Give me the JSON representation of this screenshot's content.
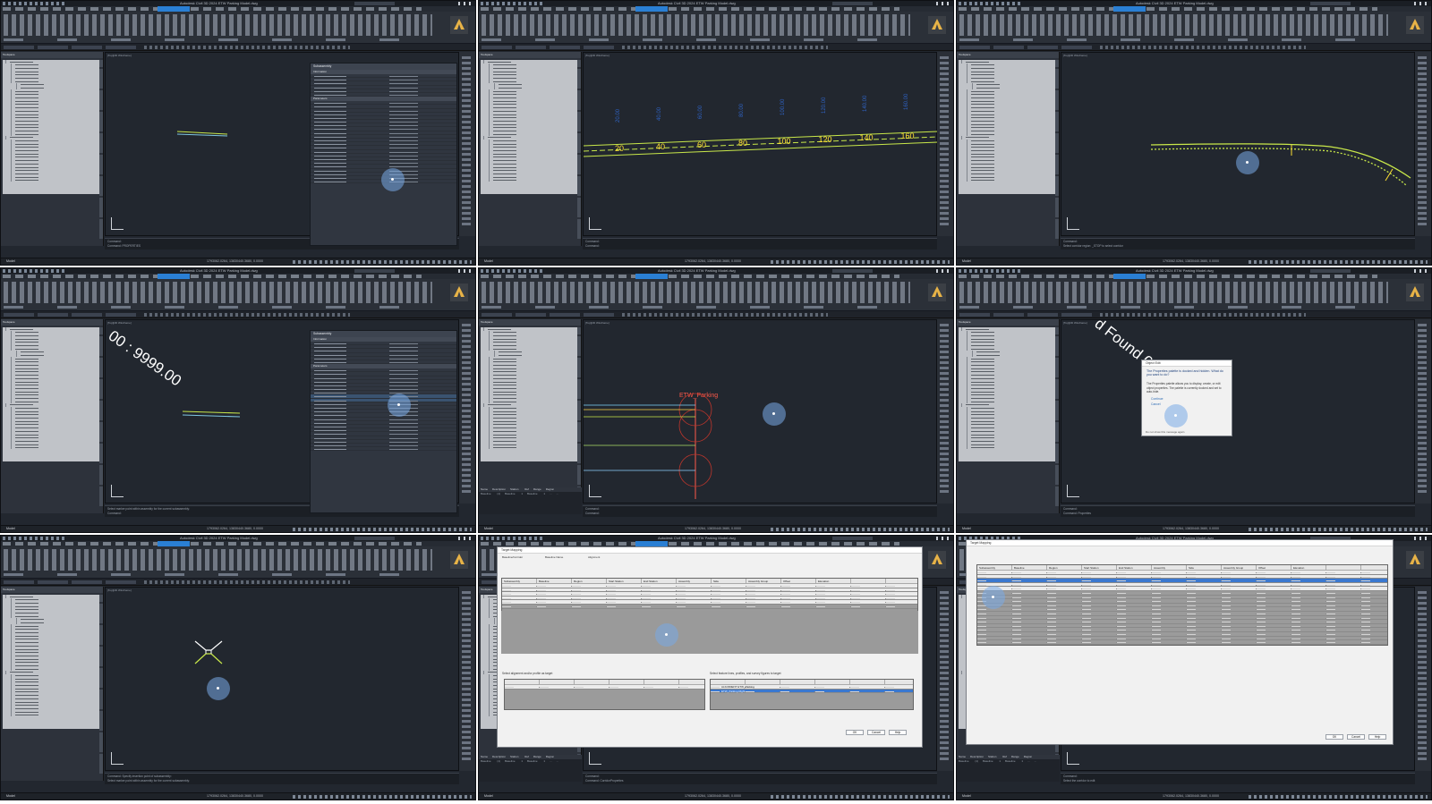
{
  "app": {
    "title": "Autodesk Civil 3D 2024   ETW Parking Model.dwg",
    "model_tab": "Model",
    "viewport_label": "[Top][2D Wireframe]",
    "coords": "1793062.0264, 13830440.3680, 0.0000",
    "status_model": "MODEL"
  },
  "toolspace": {
    "title": "Toolspace",
    "tab": "Prospector",
    "drawing": "ETW Parking Model.dwg"
  },
  "frames": [
    {
      "id": "f1",
      "cmd": [
        "Command:",
        "Command: PROPERTIES"
      ],
      "props_title": "Subassembly",
      "props_sections": [
        "Information",
        "Parameters"
      ]
    },
    {
      "id": "f2",
      "stations": [
        "20",
        "40",
        "60",
        "80",
        "100",
        "120",
        "140",
        "160"
      ],
      "top_labels": [
        "20.00",
        "40.00",
        "60.00",
        "80.00",
        "100.00",
        "120.00",
        "140.00",
        "160.00"
      ],
      "cmd": [
        "Command:",
        "Command:"
      ]
    },
    {
      "id": "f3",
      "cmd": [
        "Command:",
        "Select corridor region: _STOP to select corridor"
      ]
    },
    {
      "id": "f4",
      "rot_label": "00 : 9999.00",
      "cmd": [
        "Select marker point within assembly for the current subassembly:",
        "Command:"
      ],
      "props_title": "Subassembly",
      "props_sections": [
        "Information",
        "Parameters"
      ]
    },
    {
      "id": "f5",
      "label": "ETW_Parking",
      "cmd": [
        "Command:",
        "Command:"
      ]
    },
    {
      "id": "f6",
      "rot_label": "d Found  0.0",
      "dialog_title": "Object Edit",
      "dialog_heading": "The Properties palette is docked and hidden. What do you want to do?",
      "dialog_body": "The Properties palette allows you to display, create, or edit object properties. The palette is currently docked and set to auto-hide.",
      "dialog_options": [
        "Continue",
        "Cancel"
      ],
      "dialog_footer": "Do not show this message again",
      "cmd": [
        "Command:",
        "Command: Properties"
      ]
    },
    {
      "id": "f7",
      "cmd": [
        "Command: Specify insertion point of subassembly:",
        "Select marker point within assembly for the current subassembly:"
      ]
    },
    {
      "id": "f8",
      "dialog_title": "Target Mapping",
      "dialog_fields": [
        "Baseline/Corridor",
        "Baseline Name",
        "Alignment"
      ],
      "grid_headers": [
        "Subassembly",
        "Baseline",
        "Region",
        "Start Station",
        "End Station",
        "Assembly",
        "Side",
        "Assembly Group",
        "Offset",
        "Elevation"
      ],
      "lower_label": "Select alignment and/or profile as target",
      "right_label": "Select feature lines, profiles, and survey figures to target",
      "target_rows": [
        "ALIGNMENT ETW_Parking",
        "ETW_Parking Right"
      ],
      "buttons": [
        "OK",
        "Cancel",
        "Help"
      ],
      "cmd": [
        "Command:",
        "Command: CorridorProperties"
      ]
    },
    {
      "id": "f9",
      "dialog_title": "Target Mapping",
      "grid_headers": [
        "Subassembly",
        "Baseline",
        "Region",
        "Start Station",
        "End Station",
        "Assembly",
        "Side",
        "Assembly Group",
        "Offset",
        "Elevation"
      ],
      "buttons": [
        "OK",
        "Cancel",
        "Help"
      ],
      "cmd": [
        "Command:",
        "Select the corridor to edit"
      ]
    }
  ],
  "bottom_table": {
    "headers": [
      "Name",
      "Description",
      "Station Ref",
      "Range",
      "Region"
    ],
    "row": [
      "Baseline (1)",
      "Baseline 1",
      "Baseline 1",
      "...",
      "..."
    ]
  },
  "colors": {
    "background": "#22272f",
    "accent": "#2a7fd4",
    "alignment": "#c9e84a",
    "station_label": "#ffe033",
    "blue_label": "#2f62c2",
    "red_label": "#ff5a4a"
  }
}
